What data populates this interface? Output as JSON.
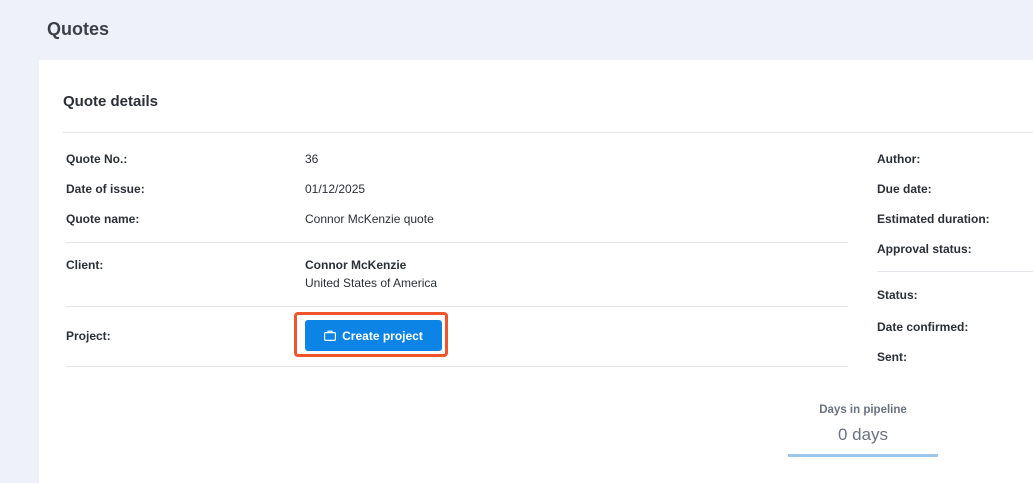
{
  "page": {
    "title": "Quotes"
  },
  "quote_details": {
    "title": "Quote details",
    "left": {
      "quote_no": {
        "label": "Quote No.:",
        "value": "36"
      },
      "date_of_issue": {
        "label": "Date of issue:",
        "value": "01/12/2025"
      },
      "quote_name": {
        "label": "Quote name:",
        "value": "Connor McKenzie quote"
      },
      "client": {
        "label": "Client:",
        "name": "Connor McKenzie",
        "country": "United States of America"
      },
      "project": {
        "label": "Project:",
        "button_label": "Create project",
        "button_icon": "briefcase-icon"
      }
    },
    "right": {
      "author": {
        "label": "Author:"
      },
      "due_date": {
        "label": "Due date:"
      },
      "estimated_duration": {
        "label": "Estimated duration:"
      },
      "approval_status": {
        "label": "Approval status:"
      },
      "status": {
        "label": "Status:"
      },
      "date_confirmed": {
        "label": "Date confirmed:"
      },
      "sent": {
        "label": "Sent:"
      }
    },
    "pipeline": {
      "label": "Days in pipeline",
      "value": "0 days"
    }
  },
  "colors": {
    "accent": "#0b84e5",
    "highlight": "#f0542a",
    "background": "#eef1f9"
  }
}
